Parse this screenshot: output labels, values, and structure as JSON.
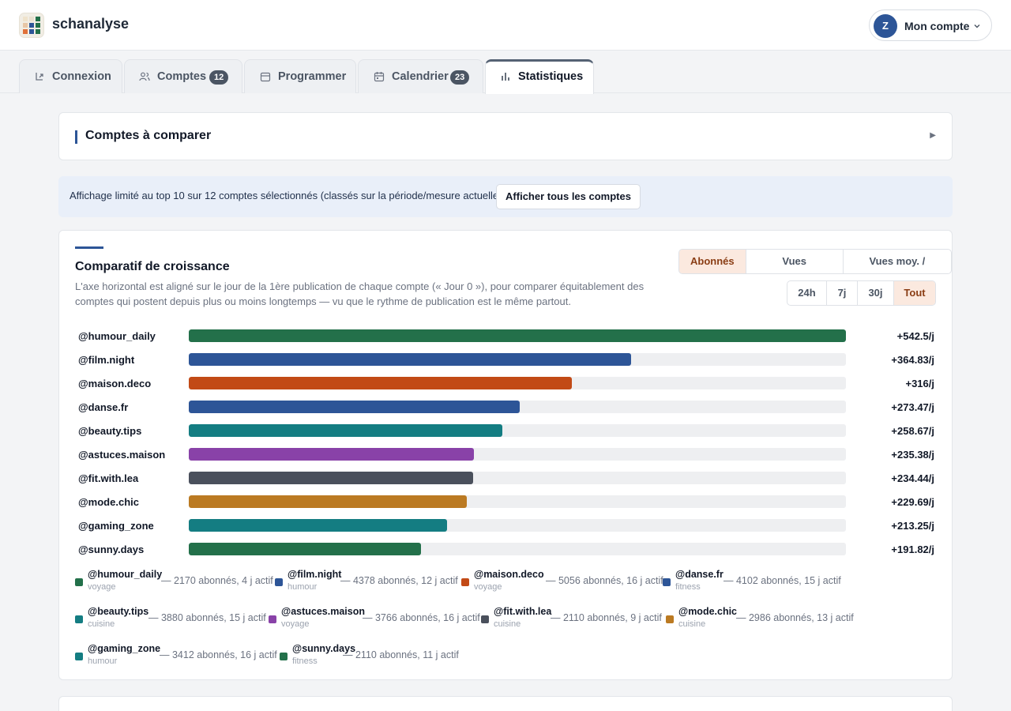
{
  "app": {
    "name": "schanalyse"
  },
  "account": {
    "initial": "Z",
    "label": "Mon compte"
  },
  "tabs": [
    {
      "label": "Connexion",
      "icon": "login-icon"
    },
    {
      "label": "Comptes",
      "icon": "users-icon",
      "badge": "12"
    },
    {
      "label": "Programmer",
      "icon": "calendar-icon"
    },
    {
      "label": "Calendrier",
      "icon": "calendar-grid-icon",
      "badge": "23"
    },
    {
      "label": "Statistiques",
      "icon": "bar-chart-icon",
      "active": true
    }
  ],
  "compare_panel": {
    "title": "Comptes à comparer"
  },
  "notice": {
    "text": "Affichage limité au top 10 sur 12 comptes sélectionnés (classés sur la période/mesure actuelle).",
    "button": "Afficher tous les comptes"
  },
  "growth": {
    "title": "Comparatif de croissance",
    "description": "L'axe horizontal est aligné sur le jour de la 1ère publication de chaque compte (« Jour 0 »), pour comparer équitablement des comptes qui postent depuis plus ou moins longtemps — vu que le rythme de publication est le même partout.",
    "metrics": [
      "Abonnés",
      "Vues cumulées",
      "Vues moy. / vidéo"
    ],
    "metric_selected": "Abonnés",
    "periods": [
      "24h",
      "7j",
      "30j",
      "Tout"
    ],
    "period_selected": "Tout",
    "colors": {
      "green": "#23704a",
      "blue": "#2d5597",
      "orange": "#c24a16",
      "teal": "#147d82",
      "purple": "#8942a8",
      "slate": "#4a505c",
      "amber": "#bb7a22"
    }
  },
  "chart_data": {
    "type": "bar",
    "orientation": "horizontal",
    "unit": "/j",
    "categories": [
      "@humour_daily",
      "@film.night",
      "@maison.deco",
      "@danse.fr",
      "@beauty.tips",
      "@astuces.maison",
      "@fit.with.lea",
      "@mode.chic",
      "@gaming_zone",
      "@sunny.days"
    ],
    "values": [
      542.5,
      364.83,
      316,
      273.47,
      258.67,
      235.38,
      234.44,
      229.69,
      213.25,
      191.82
    ],
    "labels": [
      "+542.5/j",
      "+364.83/j",
      "+316/j",
      "+273.47/j",
      "+258.67/j",
      "+235.38/j",
      "+234.44/j",
      "+229.69/j",
      "+213.25/j",
      "+191.82/j"
    ],
    "colors": [
      "#23704a",
      "#2d5597",
      "#c24a16",
      "#2d5597",
      "#147d82",
      "#8942a8",
      "#4a505c",
      "#bb7a22",
      "#147d82",
      "#23704a"
    ],
    "xlim": [
      0,
      542.5
    ],
    "legend": [
      {
        "name": "@humour_daily",
        "category": "voyage",
        "stats": "— 2170 abonnés, 4 j actif",
        "color": "#23704a"
      },
      {
        "name": "@film.night",
        "category": "humour",
        "stats": "— 4378 abonnés, 12 j actif",
        "color": "#2d5597"
      },
      {
        "name": "@maison.deco",
        "category": "voyage",
        "stats": "— 5056 abonnés, 16 j actif",
        "color": "#c24a16"
      },
      {
        "name": "@danse.fr",
        "category": "fitness",
        "stats": "— 4102 abonnés, 15 j actif",
        "color": "#2d5597"
      },
      {
        "name": "@beauty.tips",
        "category": "cuisine",
        "stats": "— 3880 abonnés, 15 j actif",
        "color": "#147d82"
      },
      {
        "name": "@astuces.maison",
        "category": "voyage",
        "stats": "— 3766 abonnés, 16 j actif",
        "color": "#8942a8"
      },
      {
        "name": "@fit.with.lea",
        "category": "cuisine",
        "stats": "— 2110 abonnés, 9 j actif",
        "color": "#4a505c"
      },
      {
        "name": "@mode.chic",
        "category": "cuisine",
        "stats": "— 2986 abonnés, 13 j actif",
        "color": "#bb7a22"
      },
      {
        "name": "@gaming_zone",
        "category": "humour",
        "stats": "— 3412 abonnés, 16 j actif",
        "color": "#147d82"
      },
      {
        "name": "@sunny.days",
        "category": "fitness",
        "stats": "— 2110 abonnés, 11 j actif",
        "color": "#23704a"
      }
    ]
  }
}
